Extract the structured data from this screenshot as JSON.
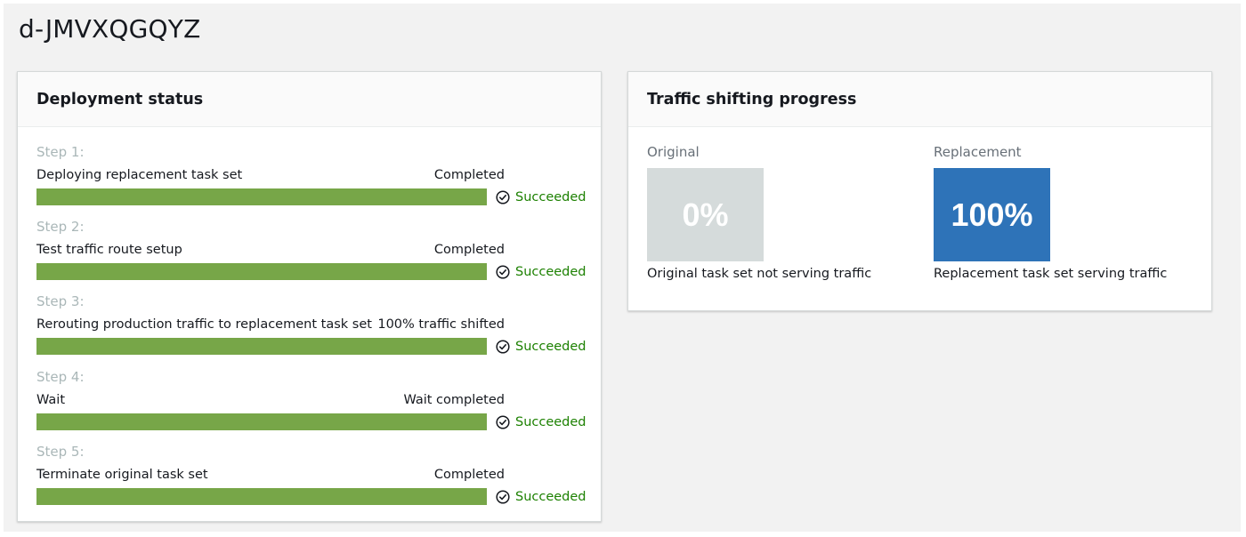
{
  "page": {
    "title": "d-JMVXQGQYZ"
  },
  "deployment": {
    "title": "Deployment status",
    "steps": [
      {
        "label": "Step 1:",
        "name": "Deploying replacement task set",
        "state": "Completed",
        "result": "Succeeded",
        "progress": 1.0
      },
      {
        "label": "Step 2:",
        "name": "Test traffic route setup",
        "state": "Completed",
        "result": "Succeeded",
        "progress": 1.0
      },
      {
        "label": "Step 3:",
        "name": "Rerouting production traffic to replacement task set",
        "state": "100% traffic shifted",
        "result": "Succeeded",
        "progress": 1.0
      },
      {
        "label": "Step 4:",
        "name": "Wait",
        "state": "Wait completed",
        "result": "Succeeded",
        "progress": 1.0
      },
      {
        "label": "Step 5:",
        "name": "Terminate original task set",
        "state": "Completed",
        "result": "Succeeded",
        "progress": 1.0
      }
    ]
  },
  "traffic": {
    "title": "Traffic shifting progress",
    "original": {
      "label": "Original",
      "percent": "0%",
      "description": "Original task set not serving traffic",
      "color": "#d5dbdb"
    },
    "replacement": {
      "label": "Replacement",
      "percent": "100%",
      "description": "Replacement task set serving traffic",
      "color": "#2e73b8"
    }
  },
  "colors": {
    "bar_fill": "#77a648",
    "success": "#1d8102"
  },
  "icons": {
    "result": "check-circle-icon"
  }
}
